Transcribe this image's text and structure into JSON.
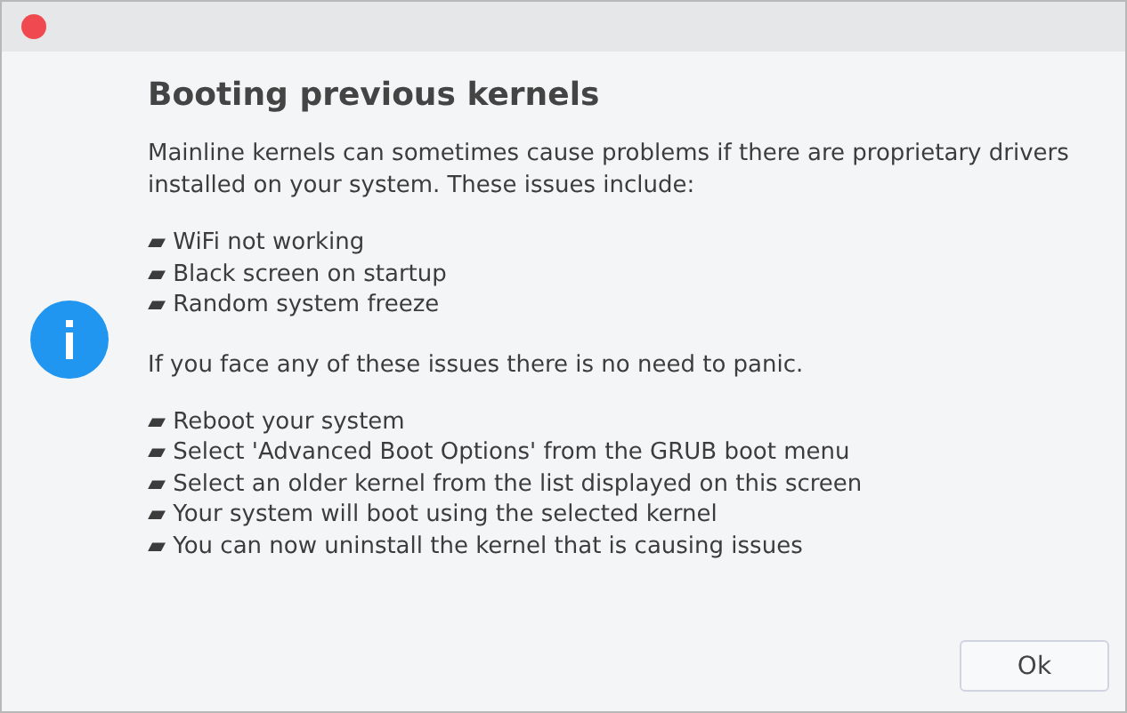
{
  "dialog": {
    "title": "Booting previous kernels",
    "intro": "Mainline kernels can sometimes cause problems if there are proprietary drivers installed on your system. These issues include:",
    "issues": [
      "▰ WiFi not working",
      "▰ Black screen on startup",
      "▰ Random system freeze"
    ],
    "advice": "If you face any of these issues there is no need to panic.",
    "steps": [
      "▰ Reboot your system",
      "▰ Select 'Advanced Boot Options' from the GRUB boot menu",
      "▰ Select an older kernel from the list displayed on this screen",
      "▰ Your system will boot using the selected kernel",
      "▰ You can now uninstall the kernel that is causing issues"
    ],
    "buttons": [
      "Ok"
    ]
  }
}
